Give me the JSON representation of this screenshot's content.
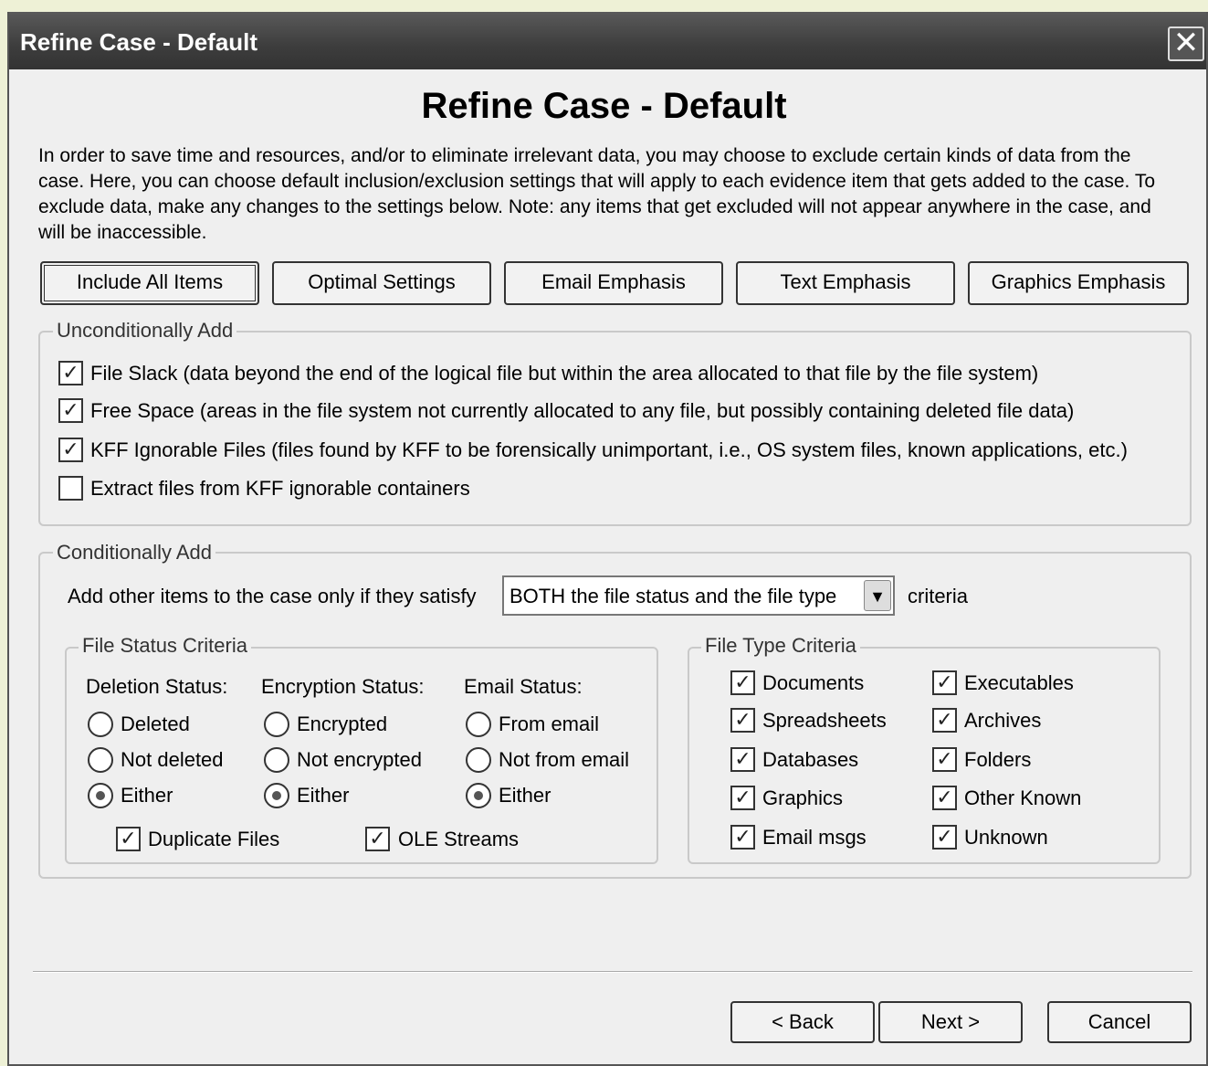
{
  "window": {
    "title": "Refine Case - Default",
    "close_glyph": "✕"
  },
  "heading": "Refine Case - Default",
  "intro": "In order to save time and resources, and/or to eliminate irrelevant data, you may choose to exclude certain kinds of data from the case. Here, you can choose default inclusion/exclusion settings that will apply to each evidence item that gets added to the case. To exclude data, make any changes to the settings below. Note: any items that get excluded will not appear anywhere in the case, and will be inaccessible.",
  "presets": [
    "Include All Items",
    "Optimal Settings",
    "Email Emphasis",
    "Text Emphasis",
    "Graphics Emphasis"
  ],
  "unconditional": {
    "legend": "Unconditionally Add",
    "items": [
      {
        "label": "File Slack (data beyond the end of the logical file but within the area allocated to that file by the file system)",
        "checked": true
      },
      {
        "label": "Free Space (areas in the file system not currently allocated to any file, but possibly containing deleted file data)",
        "checked": true
      },
      {
        "label": "KFF Ignorable Files (files found by KFF to be forensically unimportant, i.e., OS system files, known applications, etc.)",
        "checked": true
      },
      {
        "label": "Extract files from KFF ignorable containers",
        "checked": false
      }
    ]
  },
  "conditional": {
    "legend": "Conditionally Add",
    "prefix": "Add other items to the case only if they satisfy",
    "combo_value": "BOTH the file status and the file type",
    "suffix": "criteria",
    "status": {
      "legend": "File Status Criteria",
      "deletion": {
        "label": "Deletion Status:",
        "options": [
          "Deleted",
          "Not deleted",
          "Either"
        ],
        "selected": "Either"
      },
      "encryption": {
        "label": "Encryption Status:",
        "options": [
          "Encrypted",
          "Not encrypted",
          "Either"
        ],
        "selected": "Either"
      },
      "email": {
        "label": "Email Status:",
        "options": [
          "From email",
          "Not from email",
          "Either"
        ],
        "selected": "Either"
      },
      "duplicate": {
        "label": "Duplicate Files",
        "checked": true
      },
      "ole": {
        "label": "OLE Streams",
        "checked": true
      }
    },
    "type": {
      "legend": "File Type Criteria",
      "left": [
        "Documents",
        "Spreadsheets",
        "Databases",
        "Graphics",
        "Email msgs"
      ],
      "right": [
        "Executables",
        "Archives",
        "Folders",
        "Other Known",
        "Unknown"
      ]
    }
  },
  "nav": {
    "back": "< Back",
    "next": "Next >",
    "cancel": "Cancel"
  },
  "check_glyph": "✓"
}
